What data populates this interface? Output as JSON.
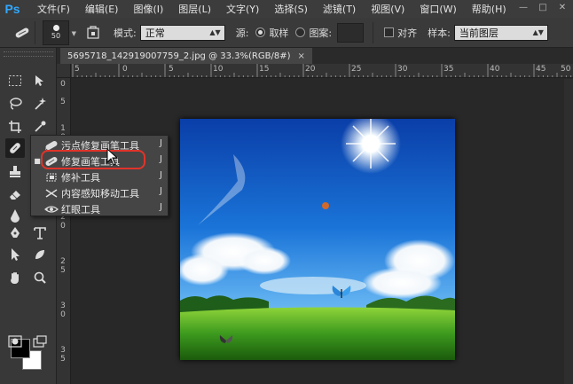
{
  "app": {
    "logo": "Ps"
  },
  "menu": [
    "文件(F)",
    "编辑(E)",
    "图像(I)",
    "图层(L)",
    "文字(Y)",
    "选择(S)",
    "滤镜(T)",
    "视图(V)",
    "窗口(W)",
    "帮助(H)"
  ],
  "window_controls": [
    "—",
    "□",
    "✕"
  ],
  "options": {
    "brush_size": "50",
    "mode_label": "模式:",
    "mode_value": "正常",
    "source_label": "源:",
    "sampled_label": "取样",
    "pattern_label": "图案:",
    "aligned_label": "对齐",
    "sample_label": "样本:",
    "sample_value": "当前图层"
  },
  "document": {
    "tab_title": "5695718_142919007759_2.jpg @ 33.3%(RGB/8#)",
    "close": "×"
  },
  "ruler": {
    "h_labels": [
      "5",
      "0",
      "5",
      "10",
      "15",
      "20",
      "25",
      "30",
      "35",
      "40",
      "45",
      "50"
    ],
    "v_labels": [
      "0",
      "5",
      "1",
      "0",
      "1",
      "5",
      "2",
      "0",
      "2",
      "5",
      "3",
      "0",
      "3",
      "5"
    ]
  },
  "flyout": {
    "items": [
      {
        "label": "污点修复画笔工具",
        "key": "J",
        "selected": false
      },
      {
        "label": "修复画笔工具",
        "key": "J",
        "selected": true
      },
      {
        "label": "修补工具",
        "key": "J",
        "selected": false
      },
      {
        "label": "内容感知移动工具",
        "key": "J",
        "selected": false
      },
      {
        "label": "红眼工具",
        "key": "J",
        "selected": false
      }
    ],
    "bullet": "■"
  },
  "colors": {
    "highlight": "#e0342a",
    "foreground": "#000000",
    "background": "#ffffff",
    "ps_blue": "#31a8ff"
  },
  "icons": [
    "healing-brush-icon",
    "brush-preset-icon",
    "clone-source-icon",
    "marquee-icon",
    "move-icon",
    "lasso-icon",
    "magic-wand-icon",
    "crop-icon",
    "eyedropper-icon",
    "healing-icon",
    "brush-icon",
    "stamp-icon",
    "history-brush-icon",
    "eraser-icon",
    "gradient-icon",
    "blur-icon",
    "dodge-icon",
    "pen-icon",
    "type-icon",
    "path-select-icon",
    "shape-icon",
    "hand-icon",
    "zoom-icon"
  ]
}
